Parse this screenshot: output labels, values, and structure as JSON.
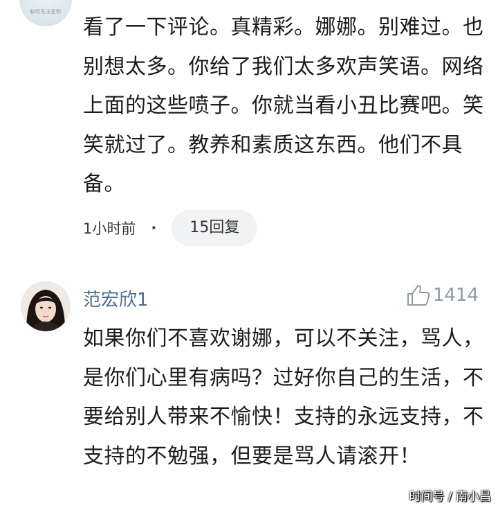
{
  "top_comment": {
    "avatar_caption": "聪明无法复制",
    "text": "看了一下评论。真精彩。娜娜。别难过。也别想太多。你给了我们太多欢声笑语。网络上面的这些喷子。你就当看小丑比赛吧。笑笑就过了。教养和素质这东西。他们不具备。",
    "time": "1小时前",
    "separator": "·",
    "reply_count": "15回复"
  },
  "second_comment": {
    "username": "范宏欣1",
    "like_count": "1414",
    "text": "如果你们不喜欢谢娜，可以不关注，骂人，是你们心里有病吗？过好你自己的生活，不要给别人带来不愉快！支持的永远支持，不支持的不勉强，但要是骂人请滚开！"
  },
  "watermark": "时间号 / 南小昌",
  "icons": {
    "like": "thumbs-up-icon"
  }
}
